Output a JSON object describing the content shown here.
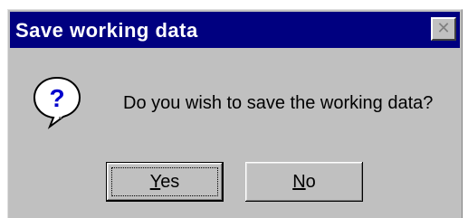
{
  "dialog": {
    "title": "Save working data",
    "close_glyph": "✕",
    "message": "Do you wish to save the working data?",
    "icon": "question-icon",
    "buttons": {
      "yes": {
        "mnemonic": "Y",
        "rest": "es"
      },
      "no": {
        "mnemonic": "N",
        "rest": "o"
      }
    }
  },
  "colors": {
    "titlebar": "#000080",
    "face": "#c0c0c0",
    "icon_fill": "#0000cc"
  }
}
